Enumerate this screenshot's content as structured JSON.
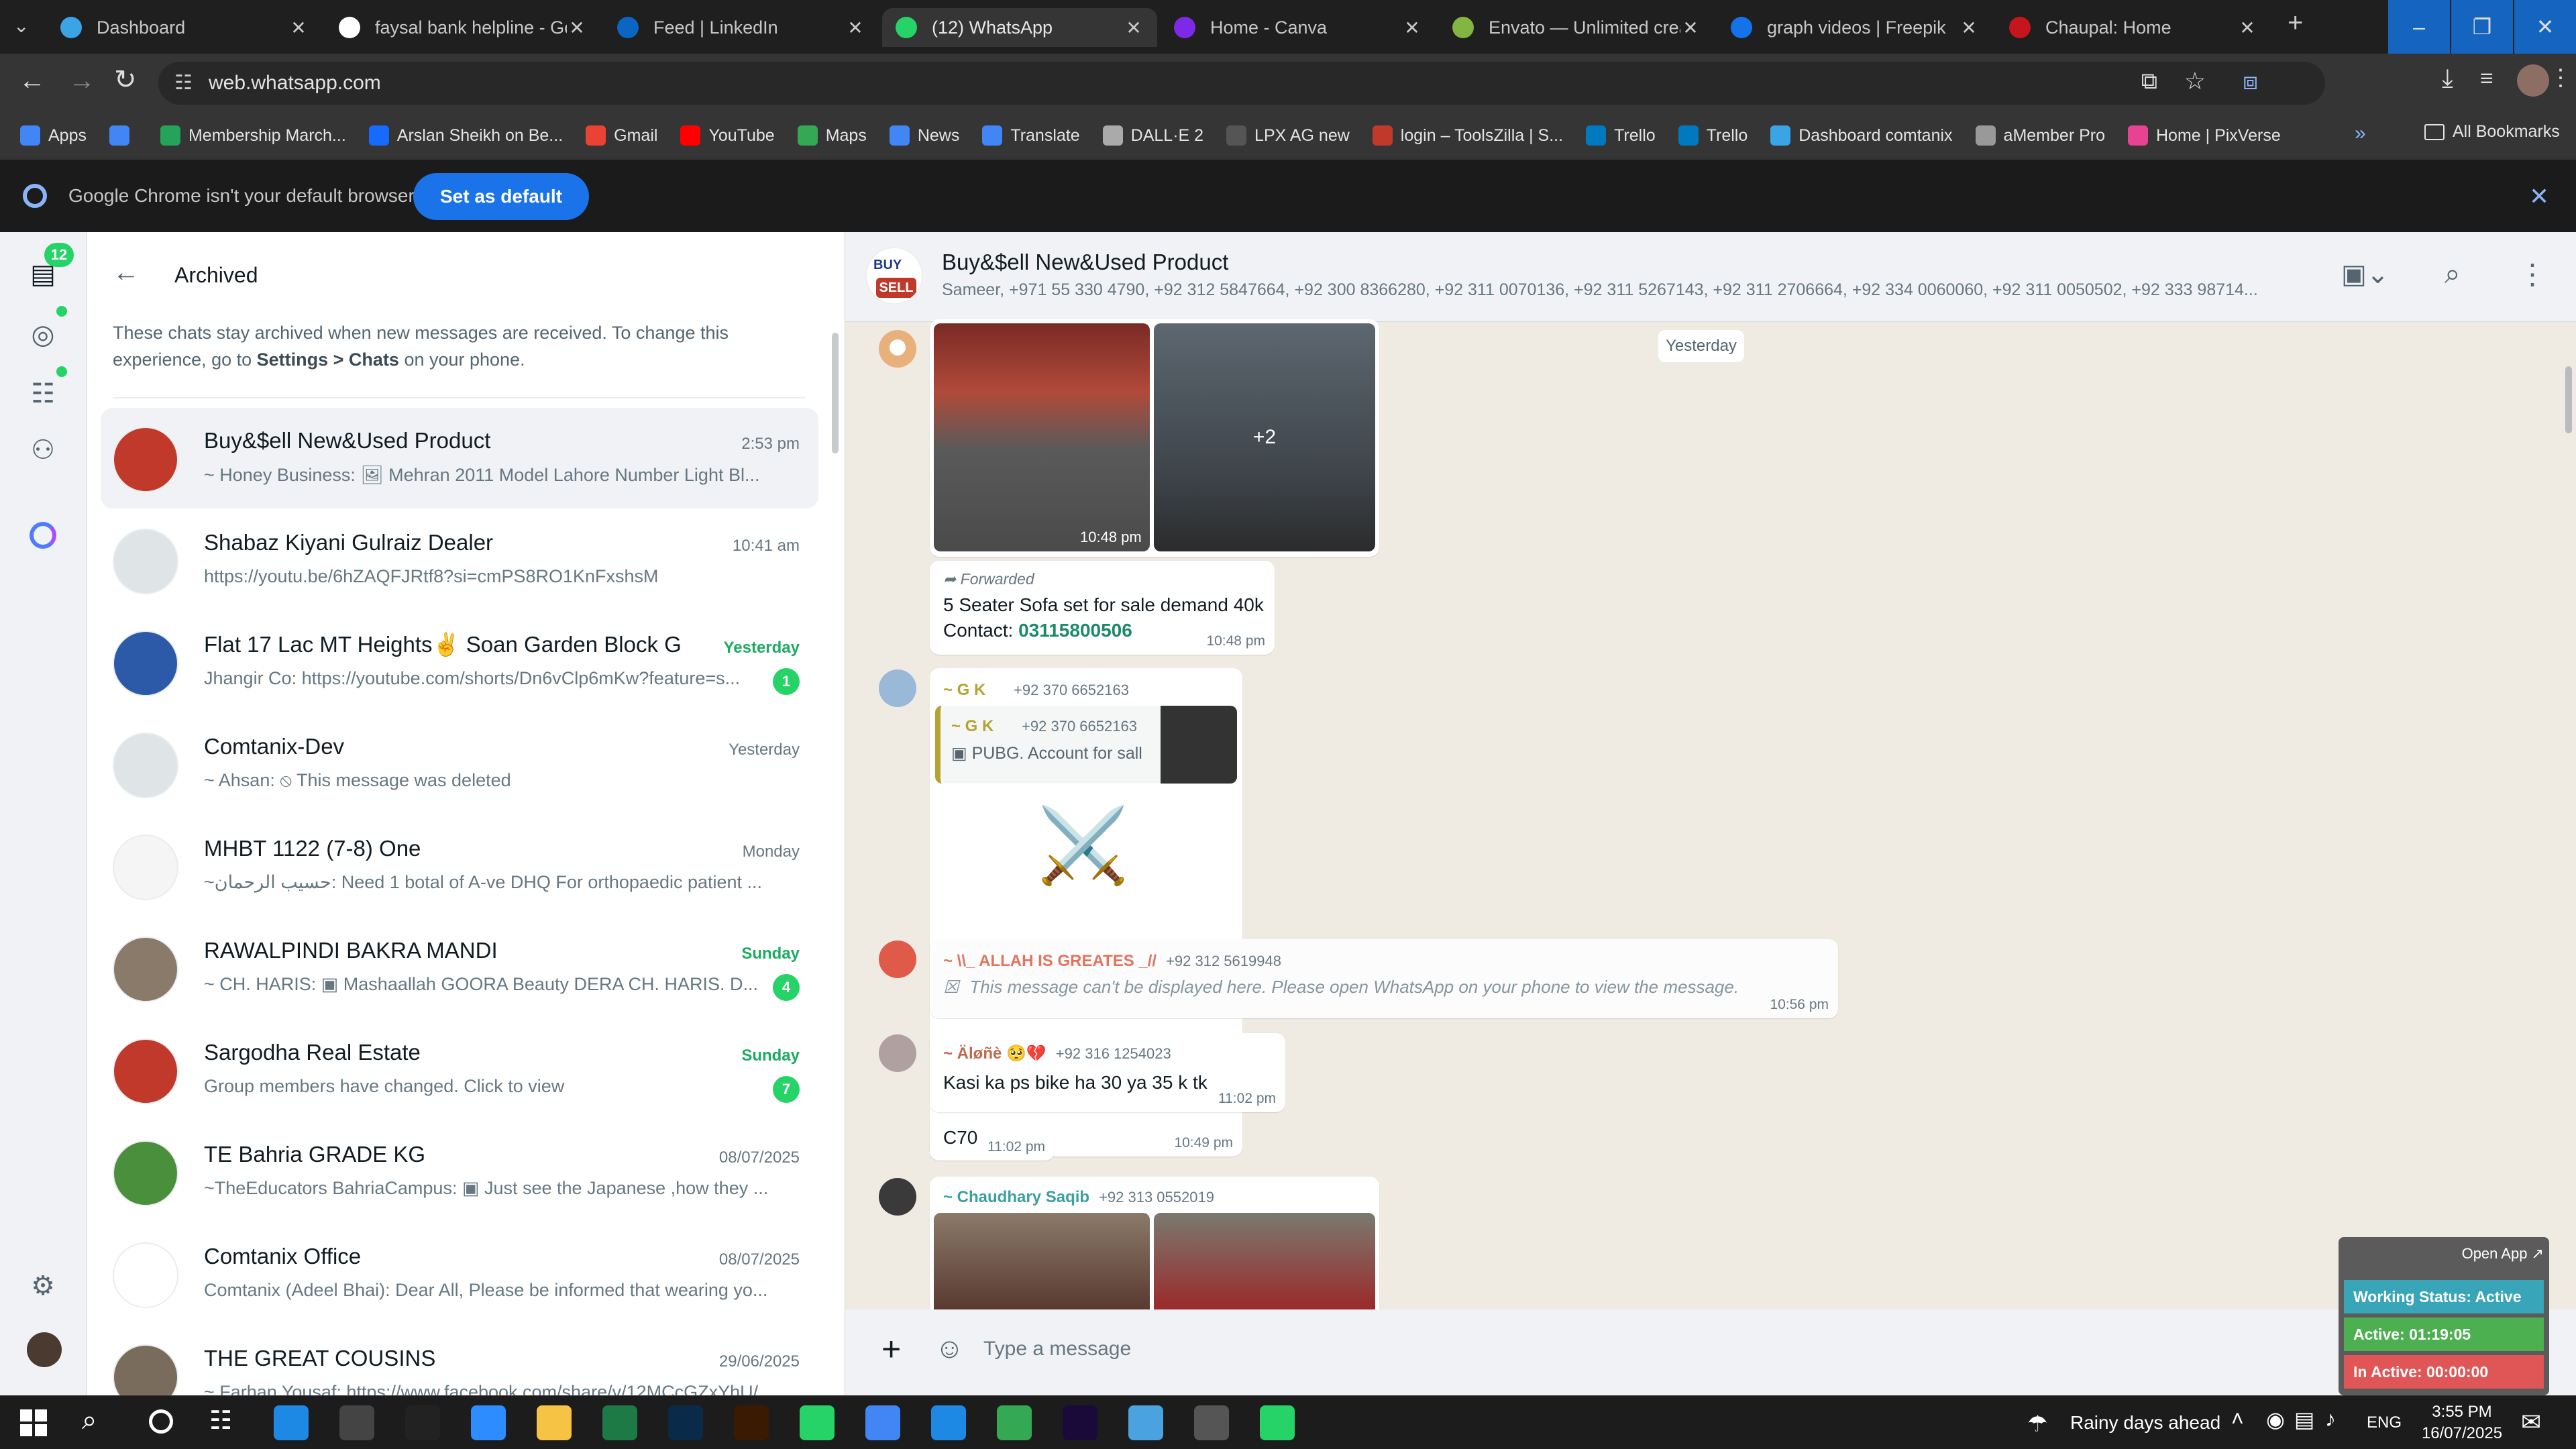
{
  "browser": {
    "tabs": [
      {
        "title": "Dashboard",
        "icon": "dashboard-tab-icon",
        "color": "#3ba4e6"
      },
      {
        "title": "faysal bank helpline - Goo",
        "icon": "google-tab-icon",
        "color": "#ffffff"
      },
      {
        "title": "Feed | LinkedIn",
        "icon": "linkedin-tab-icon",
        "color": "#0a66c2"
      },
      {
        "title": "(12) WhatsApp",
        "icon": "whatsapp-tab-icon",
        "color": "#25d366"
      },
      {
        "title": "Home - Canva",
        "icon": "canva-tab-icon",
        "color": "#7d2ae8"
      },
      {
        "title": "Envato — Unlimited creat",
        "icon": "envato-tab-icon",
        "color": "#82b541"
      },
      {
        "title": "graph videos | Freepik",
        "icon": "freepik-tab-icon",
        "color": "#1273eb"
      },
      {
        "title": "Chaupal: Home",
        "icon": "chaupal-tab-icon",
        "color": "#c4161c"
      }
    ],
    "url": "web.whatsapp.com",
    "bookmarks": [
      {
        "label": "Apps",
        "color": "#4285f4"
      },
      {
        "label": "",
        "color": "#4285f4"
      },
      {
        "label": "Membership March...",
        "color": "#25a35a"
      },
      {
        "label": "Arslan Sheikh on Be...",
        "color": "#1769ff"
      },
      {
        "label": "Gmail",
        "color": "#ea4335"
      },
      {
        "label": "YouTube",
        "color": "#ff0000"
      },
      {
        "label": "Maps",
        "color": "#34a853"
      },
      {
        "label": "News",
        "color": "#4285f4"
      },
      {
        "label": "Translate",
        "color": "#4285f4"
      },
      {
        "label": "DALL·E 2",
        "color": "#aaaaaa"
      },
      {
        "label": "LPX AG new",
        "color": "#555555"
      },
      {
        "label": "login – ToolsZilla | S...",
        "color": "#c0392b"
      },
      {
        "label": "Trello",
        "color": "#0079bf"
      },
      {
        "label": "Trello",
        "color": "#0079bf"
      },
      {
        "label": "Dashboard comtanix",
        "color": "#3ba4e6"
      },
      {
        "label": "aMember Pro",
        "color": "#999999"
      },
      {
        "label": "Home | PixVerse",
        "color": "#e84393"
      }
    ],
    "all_bookmarks": "All Bookmarks",
    "default_msg": "Google Chrome isn't your default browser",
    "set_default": "Set as default"
  },
  "nav": {
    "chats_badge": "12"
  },
  "archived": {
    "title": "Archived",
    "info_line1": "These chats stay archived when new messages are received. To change this",
    "info_pre": "experience, go to ",
    "info_settings": "Settings > Chats",
    "info_post": " on your phone."
  },
  "chats": [
    {
      "name": "Buy&$ell New&Used Product",
      "time": "2:53 pm",
      "preview": "~ Honey Business: 🖼 Mehran 2011 Model  Lahore Number  Light Bl...",
      "badge": "",
      "green": false,
      "av": "#c0392b"
    },
    {
      "name": "Shabaz Kiyani Gulraiz Dealer",
      "time": "10:41 am",
      "preview": "https://youtu.be/6hZAQFJRtf8?si=cmPS8RO1KnFxshsM",
      "badge": "",
      "green": false,
      "av": "#dfe5e7"
    },
    {
      "name": "Flat 17 Lac MT Heights✌️  Soan Garden Block G",
      "time": "Yesterday",
      "preview": "Jhangir Co: https://youtube.com/shorts/Dn6vClp6mKw?feature=s...",
      "badge": "1",
      "green": true,
      "av": "#2d5aa8"
    },
    {
      "name": "Comtanix-Dev",
      "time": "Yesterday",
      "preview": "~ Ahsan: ⦸ This message was deleted",
      "badge": "",
      "green": false,
      "av": "#dfe5e7"
    },
    {
      "name": "MHBT 1122 (7-8) One",
      "time": "Monday",
      "preview": "~حسیب الرحمان: Need 1 botal of A-ve DHQ For orthopaedic patient ...",
      "badge": "",
      "green": false,
      "av": "#f5f5f5"
    },
    {
      "name": "RAWALPINDI BAKRA MANDI",
      "time": "Sunday",
      "preview": "~ CH. HARIS: ▣ Mashaallah GOORA  Beauty DERA CH. HARIS. D...",
      "badge": "4",
      "green": true,
      "av": "#8a7a6a"
    },
    {
      "name": "Sargodha Real Estate",
      "time": "Sunday",
      "preview": "Group members have changed. Click to view",
      "badge": "7",
      "green": true,
      "av": "#c0392b"
    },
    {
      "name": "TE Bahria GRADE KG",
      "time": "08/07/2025",
      "preview": "~TheEducators BahriaCampus: ▣ Just see  the Japanese ,how they ...",
      "badge": "",
      "green": false,
      "av": "#4a8f3c"
    },
    {
      "name": "Comtanix Office",
      "time": "08/07/2025",
      "preview": "Comtanix (Adeel Bhai): Dear All,  Please be informed that wearing yo...",
      "badge": "",
      "green": false,
      "av": "#ffffff"
    },
    {
      "name": "THE GREAT COUSINS",
      "time": "29/06/2025",
      "preview": "~ Farhan Yousaf: https://www.facebook.com/share/v/12MCcGZxYhU/...",
      "badge": "",
      "green": false,
      "av": "#7a6c5d"
    }
  ],
  "conversation": {
    "title": "Buy&$ell New&Used Product",
    "members": "Sameer, +971 55 330 4790, +92 312 5847664, +92 300 8366280, +92 311 0070136, +92 311 5267143, +92 311 2706664, +92 334 0060060, +92 311 0050502, +92 333 98714...",
    "date_chip": "Yesterday",
    "photos_time": "10:48 pm",
    "more_count": "+2",
    "forwarded": "Forwarded",
    "sofa_text": "5 Seater Sofa set for sale demand 40k",
    "contact_label": "Contact: ",
    "contact_number": "03115800506",
    "sofa_time": "10:48 pm",
    "gk_name": "~ G K",
    "gk_phone": "+92 370 6652163",
    "gk_quote_name": "~ G K",
    "gk_quote_phone": "+92 370 6652163",
    "gk_quote_text": "PUBG. Account for sall",
    "gk_emoji": "⚔️",
    "gk_time": "10:49 pm",
    "allah_name": "~ \\\\_ ALLAH IS GREATES _//",
    "allah_phone": "+92 312 5619948",
    "allah_text": "This message can't be displayed here. Please open WhatsApp on your phone to view the message.",
    "allah_time": "10:56 pm",
    "alone_name": "~ Äløñè 🥺💔",
    "alone_phone": "+92 316 1254023",
    "alone_text": "Kasi ka ps bike ha 30 ya 35 k tk",
    "alone_time": "11:02 pm",
    "c70_text": "C70",
    "c70_time": "11:02 pm",
    "saqib_name": "~ Chaudhary Saqib",
    "saqib_phone": "+92 313 0552019",
    "composer_placeholder": "Type a message"
  },
  "widget": {
    "open_app": "Open App ↗",
    "working": "Working Status: Active",
    "active": "Active: 01:19:05",
    "inactive": "In Active: 00:00:00"
  },
  "taskbar": {
    "weather": "Rainy days ahead",
    "lang": "ENG",
    "time": "3:55 PM",
    "date": "16/07/2025"
  }
}
